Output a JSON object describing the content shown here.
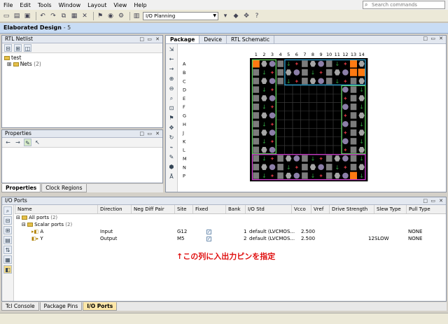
{
  "menu": [
    "File",
    "Edit",
    "Tools",
    "Window",
    "Layout",
    "View",
    "Help"
  ],
  "search": {
    "placeholder": "Search commands"
  },
  "toolbar": {
    "layout_value": "I/O Planning"
  },
  "design_header": {
    "title": "Elaborated Design",
    "suffix": "- 5"
  },
  "rtl_netlist": {
    "title": "RTL Netlist",
    "tree": {
      "root": "test",
      "child": "Nets",
      "child_count": "(2)"
    }
  },
  "properties": {
    "title": "Properties"
  },
  "left_tabs": [
    "Properties",
    "Clock Regions"
  ],
  "package": {
    "tabs": [
      "Package",
      "Device",
      "RTL Schematic"
    ],
    "columns": [
      "1",
      "2",
      "3",
      "4",
      "5",
      "6",
      "7",
      "8",
      "9",
      "10",
      "11",
      "12",
      "13",
      "14"
    ],
    "rows": [
      "A",
      "B",
      "C",
      "D",
      "E",
      "F",
      "G",
      "H",
      "J",
      "K",
      "L",
      "M",
      "N",
      "P"
    ]
  },
  "io_ports": {
    "title": "I/O Ports",
    "columns": [
      "Name",
      "Direction",
      "Neg Diff Pair",
      "Site",
      "Fixed",
      "Bank",
      "I/O Std",
      "Vcco",
      "Vref",
      "Drive Strength",
      "Slew Type",
      "Pull Type"
    ],
    "groups": {
      "all": "All ports",
      "all_count": "(2)",
      "scalar": "Scalar ports",
      "scalar_count": "(2)"
    },
    "ports": [
      {
        "name": "A",
        "direction": "Input",
        "site": "G12",
        "fixed": true,
        "bank": "1",
        "iostd": "default (LVCMOS...",
        "vcco": "2.500",
        "drive": "",
        "slew": "",
        "pull": "NONE"
      },
      {
        "name": "Y",
        "direction": "Output",
        "site": "M5",
        "fixed": true,
        "bank": "2",
        "iostd": "default (LVCMOS...",
        "vcco": "2.500",
        "drive": "12",
        "slew": "SLOW",
        "pull": "NONE"
      }
    ]
  },
  "annotation": "↑この列に入出力ピンを指定",
  "bottom_tabs": [
    "Tcl Console",
    "Package Pins",
    "I/O Ports"
  ]
}
